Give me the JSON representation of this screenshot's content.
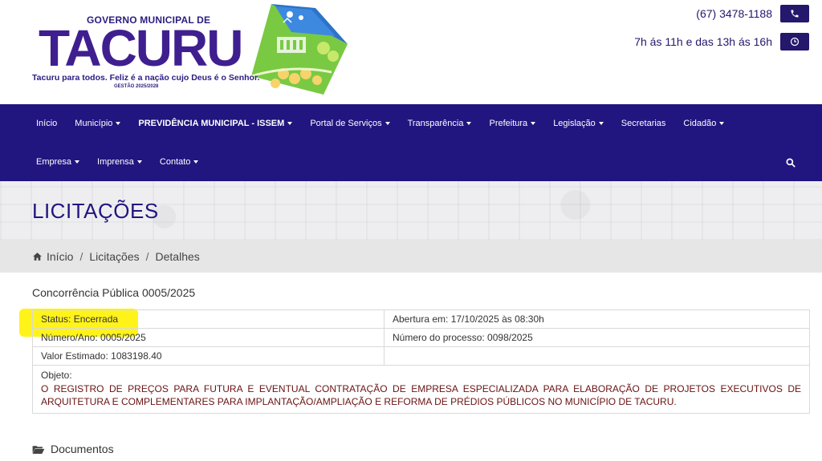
{
  "header": {
    "logo": {
      "gov_label": "GOVERNO MUNICIPAL DE",
      "name": "TACURU",
      "slogan": "Tacuru para todos. Feliz é a nação cujo Deus é o Senhor.",
      "gestao": "GESTÃO 2025/2028"
    },
    "phone": "(67) 3478-1188",
    "hours": "7h ás 11h e das 13h ás 16h",
    "phone_icon": "phone-icon",
    "clock_icon": "clock-icon"
  },
  "nav": {
    "row1": [
      {
        "label": "Início",
        "dropdown": false
      },
      {
        "label": "Município",
        "dropdown": true
      },
      {
        "label": "PREVIDÊNCIA MUNICIPAL - ISSEM",
        "dropdown": true
      },
      {
        "label": "Portal de Serviços",
        "dropdown": true
      },
      {
        "label": "Transparência",
        "dropdown": true
      },
      {
        "label": "Prefeitura",
        "dropdown": true
      },
      {
        "label": "Legislação",
        "dropdown": true
      },
      {
        "label": "Secretarias",
        "dropdown": false
      },
      {
        "label": "Cidadão",
        "dropdown": true
      }
    ],
    "row2": [
      {
        "label": "Empresa",
        "dropdown": true
      },
      {
        "label": "Imprensa",
        "dropdown": true
      },
      {
        "label": "Contato",
        "dropdown": true
      }
    ],
    "search_icon": "search-icon"
  },
  "page": {
    "title": "LICITAÇÕES"
  },
  "breadcrumb": {
    "home": "Início",
    "section": "Licitações",
    "current": "Detalhes",
    "separator": "/"
  },
  "process": {
    "title": "Concorrência Pública 0005/2025",
    "status": "Status: Encerrada",
    "abertura": "Abertura em: 17/10/2025 às 08:30h",
    "numero_ano": "Número/Ano: 0005/2025",
    "numero_processo": "Número do processo: 0098/2025",
    "valor_estimado": "Valor Estimado: 1083198.40",
    "objeto_label": "Objeto:",
    "objeto_text": "O REGISTRO DE PREÇOS PARA FUTURA E EVENTUAL CONTRATAÇÃO DE EMPRESA ESPECIALIZADA PARA ELABORAÇÃO DE PROJETOS EXECUTIVOS DE ARQUITETURA E COMPLEMENTARES PARA IMPLANTAÇÃO/AMPLIAÇÃO E REFORMA DE PRÉDIOS PÚBLICOS NO MUNICÍPIO DE TACURU."
  },
  "documents": {
    "label": "Documentos",
    "icon": "folder-open-icon"
  },
  "colors": {
    "primary": "#21157f",
    "highlight": "#fff200",
    "object_text": "#6a1212",
    "breadcrumb_bg": "#e6e6e6"
  }
}
